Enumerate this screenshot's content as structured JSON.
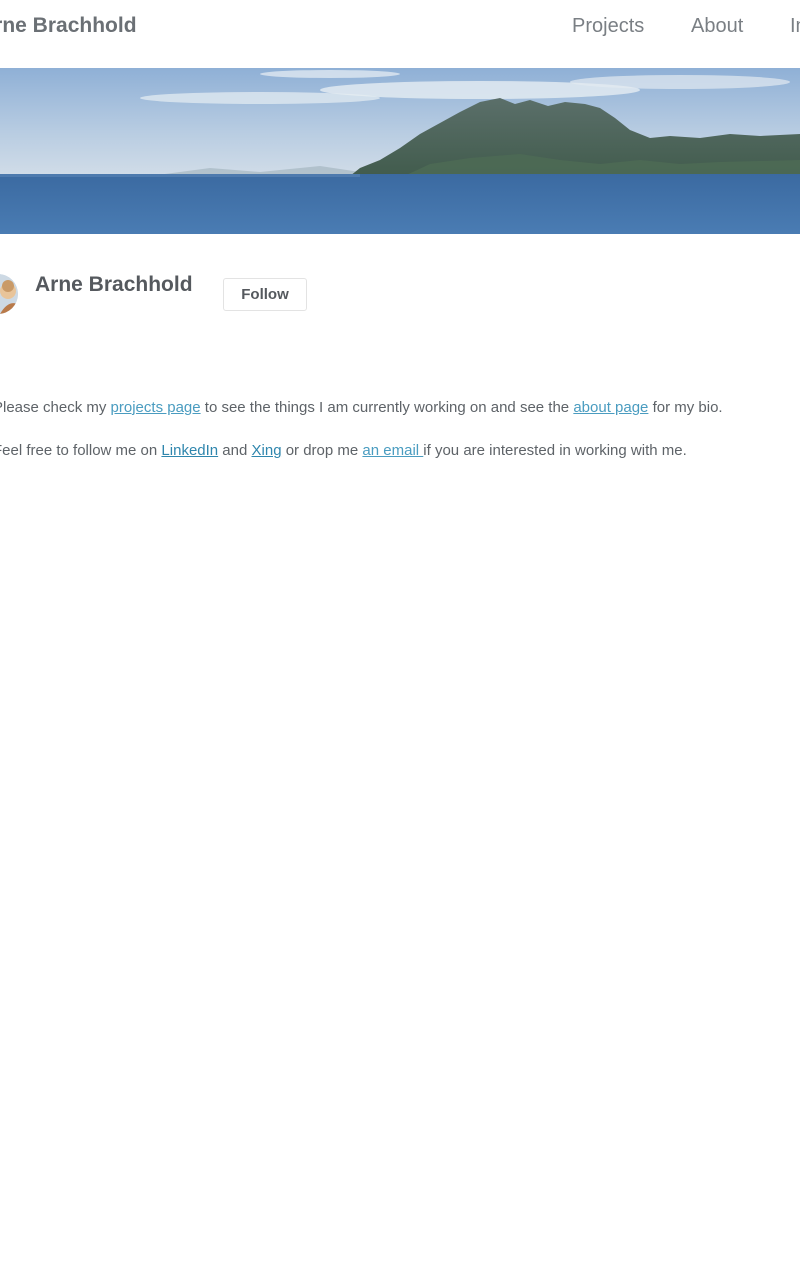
{
  "header": {
    "site_title": "Arne Brachhold",
    "nav": {
      "projects": "Projects",
      "about": "About",
      "clipped": "Imprint"
    }
  },
  "banner": {
    "description_icon": "coastline-photo"
  },
  "profile": {
    "name": "Arne Brachhold",
    "follow_label": "Follow"
  },
  "content": {
    "para1": {
      "t1": "Please check my ",
      "link1": "projects page",
      "t2": " to see the things I am currently working on and see the ",
      "link2": "about page",
      "t3": " for my bio."
    },
    "para2": {
      "t1": "Feel free to follow me on ",
      "link1": "LinkedIn",
      "t2": " and ",
      "link2": "Xing",
      "t3": " or drop me ",
      "link3": "an email ",
      "t4": "if you are interested in working with me."
    }
  },
  "colors": {
    "link": "#4a9cc0",
    "text": "#5e6368",
    "sea": "#3f6ea3"
  }
}
